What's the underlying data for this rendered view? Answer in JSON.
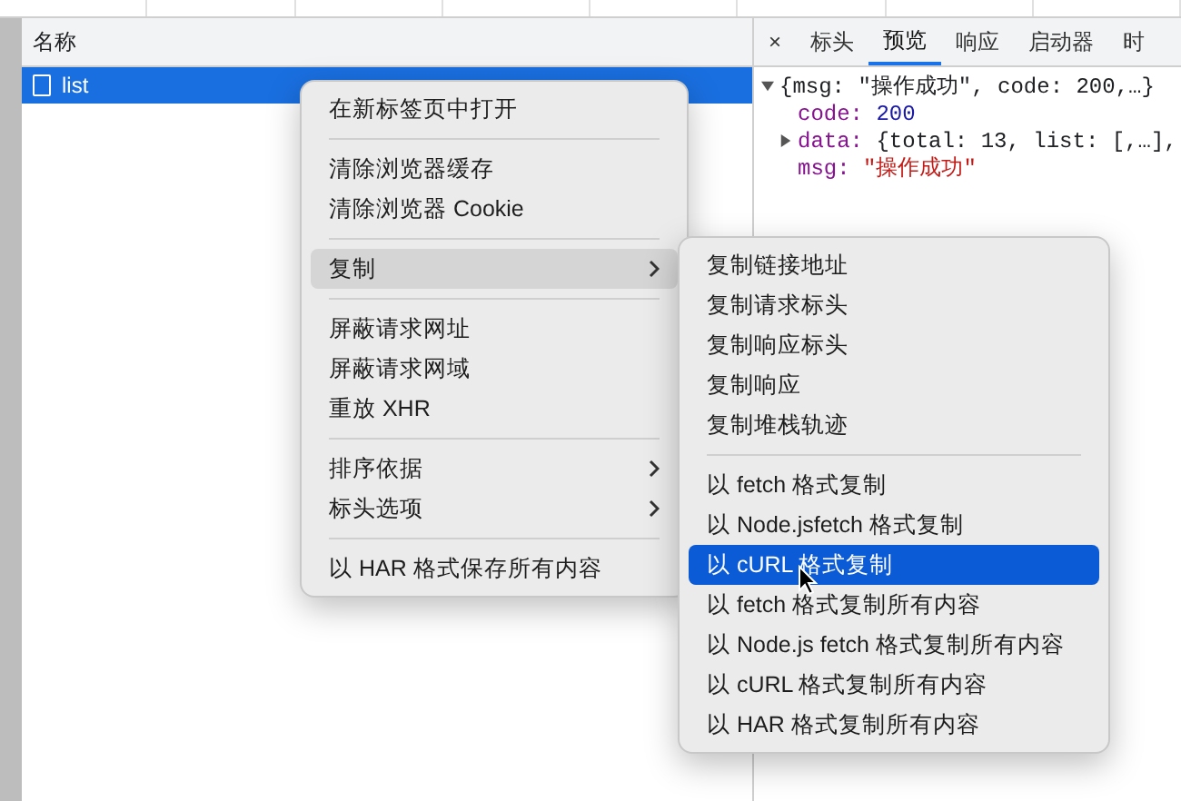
{
  "columns": [
    {
      "label": "名称"
    }
  ],
  "requests": [
    {
      "name": "list",
      "selected": true
    }
  ],
  "detail_tabs": {
    "close": "×",
    "tabs": [
      {
        "label": "标头",
        "selected": false
      },
      {
        "label": "预览",
        "selected": true
      },
      {
        "label": "响应",
        "selected": false
      },
      {
        "label": "启动器",
        "selected": false
      },
      {
        "label": "时",
        "selected": false
      }
    ]
  },
  "preview": {
    "summary": "{msg: \"操作成功\", code: 200,…}",
    "expanded": true,
    "properties": [
      {
        "key": "code:",
        "value": "200",
        "kind": "number"
      },
      {
        "key": "data:",
        "value": "{total: 13, list: [,…],",
        "kind": "object",
        "expanded": false
      },
      {
        "key": "msg:",
        "value": "\"操作成功\"",
        "kind": "string"
      }
    ]
  },
  "context_menu": {
    "groups": [
      [
        {
          "label": "在新标签页中打开",
          "submenu": false,
          "selected": false
        }
      ],
      [
        {
          "label": "清除浏览器缓存",
          "submenu": false,
          "selected": false
        },
        {
          "label": "清除浏览器 Cookie",
          "submenu": false,
          "selected": false
        }
      ],
      [
        {
          "label": "复制",
          "submenu": true,
          "selected": true
        }
      ],
      [
        {
          "label": "屏蔽请求网址",
          "submenu": false,
          "selected": false
        },
        {
          "label": "屏蔽请求网域",
          "submenu": false,
          "selected": false
        },
        {
          "label": "重放 XHR",
          "submenu": false,
          "selected": false
        }
      ],
      [
        {
          "label": "排序依据",
          "submenu": true,
          "selected": false
        },
        {
          "label": "标头选项",
          "submenu": true,
          "selected": false
        }
      ],
      [
        {
          "label": "以 HAR 格式保存所有内容",
          "submenu": false,
          "selected": false
        }
      ]
    ]
  },
  "copy_submenu": {
    "groups": [
      [
        {
          "label": "复制链接地址",
          "selected": false
        },
        {
          "label": "复制请求标头",
          "selected": false
        },
        {
          "label": "复制响应标头",
          "selected": false
        },
        {
          "label": "复制响应",
          "selected": false
        },
        {
          "label": "复制堆栈轨迹",
          "selected": false
        }
      ],
      [
        {
          "label": "以 fetch 格式复制",
          "selected": false
        },
        {
          "label": "以 Node.jsfetch 格式复制",
          "selected": false
        },
        {
          "label": "以 cURL 格式复制",
          "selected": true
        },
        {
          "label": "以 fetch 格式复制所有内容",
          "selected": false
        },
        {
          "label": "以 Node.js fetch 格式复制所有内容",
          "selected": false
        },
        {
          "label": "以 cURL 格式复制所有内容",
          "selected": false
        },
        {
          "label": "以 HAR 格式复制所有内容",
          "selected": false
        }
      ]
    ]
  }
}
